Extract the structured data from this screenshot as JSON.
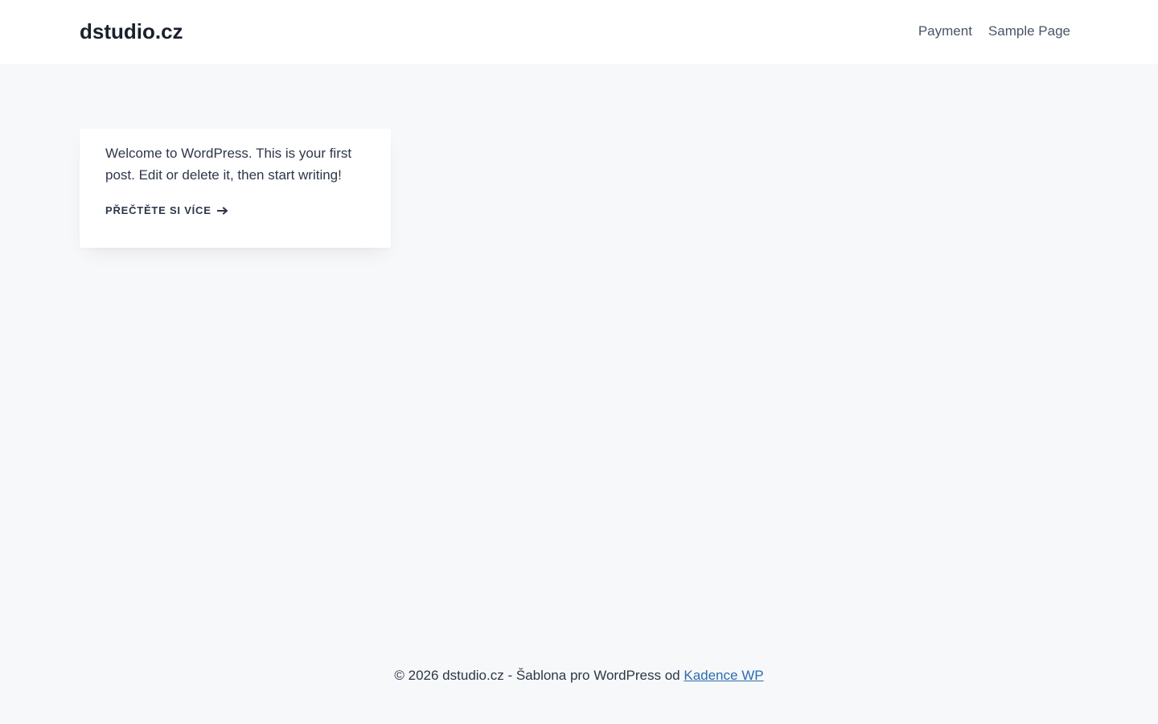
{
  "header": {
    "site_title": "dstudio.cz",
    "nav": [
      {
        "label": "Payment"
      },
      {
        "label": "Sample Page"
      }
    ]
  },
  "post": {
    "excerpt": "Welcome to WordPress. This is your first post. Edit or delete it, then start writing!",
    "read_more_label": "PŘEČTĚTE SI VÍCE",
    "read_more_icon": "arrow-right-icon"
  },
  "footer": {
    "text": "© 2026 dstudio.cz - Šablona pro WordPress od ",
    "link_label": "Kadence WP"
  },
  "colors": {
    "page_background": "#f7f8fa",
    "header_background": "#ffffff",
    "text": "#2d3748",
    "link": "#2b6cb0"
  }
}
